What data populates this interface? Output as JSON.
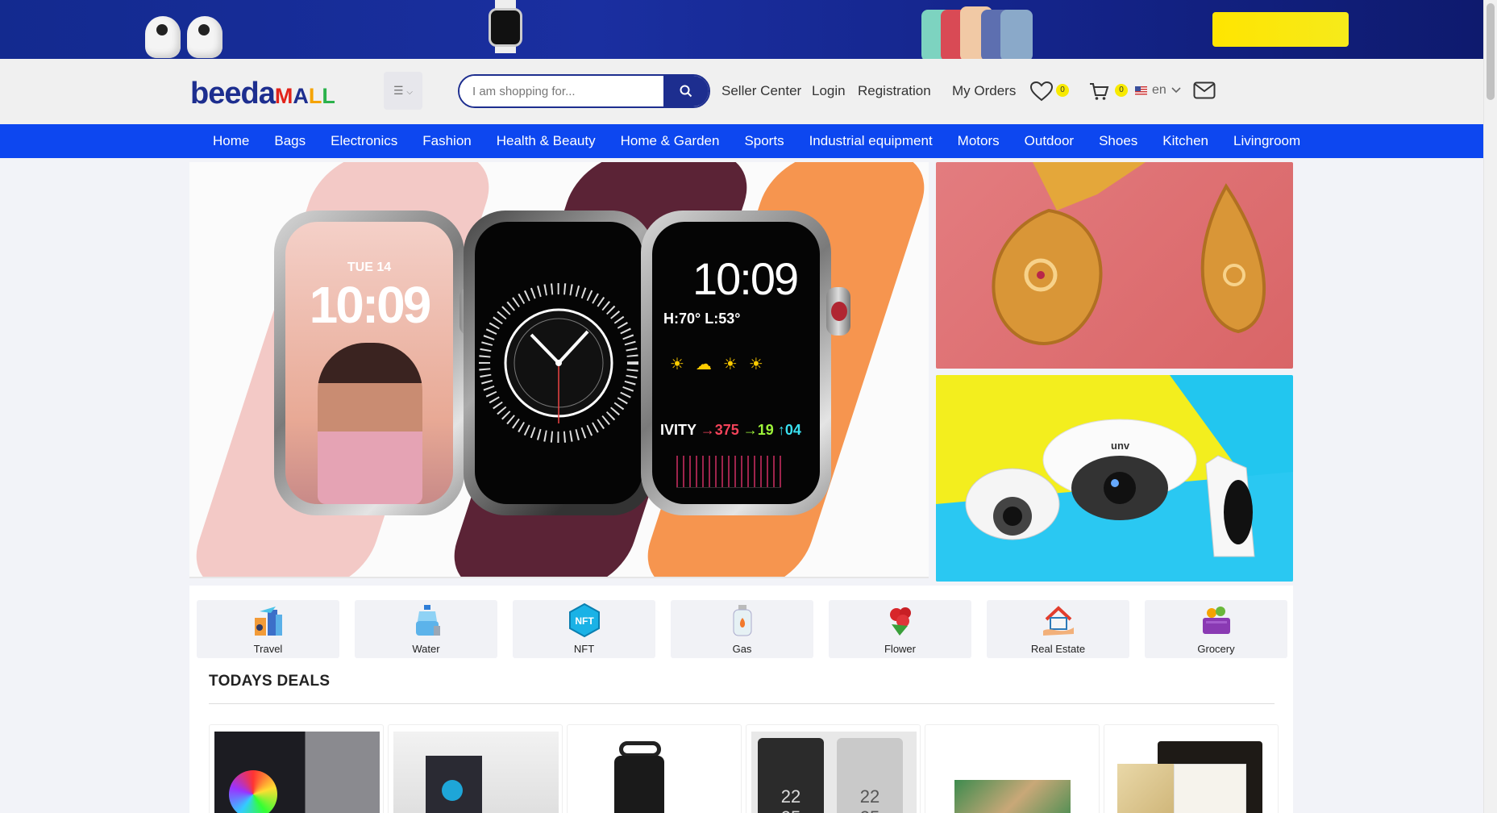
{
  "header": {
    "search": {
      "placeholder": "I am shopping for..."
    },
    "links": {
      "seller_center": "Seller Center",
      "login": "Login",
      "registration": "Registration",
      "my_orders": "My Orders"
    },
    "wishlist_count": "0",
    "cart_count": "0",
    "language": "en"
  },
  "nav": {
    "items": [
      "Home",
      "Bags",
      "Electronics",
      "Fashion",
      "Health & Beauty",
      "Home & Garden",
      "Sports",
      "Industrial equipment",
      "Motors",
      "Outdoor",
      "Shoes",
      "Kitchen",
      "Livingroom"
    ]
  },
  "hero": {
    "watch1": {
      "day": "TUE 14",
      "time": "10:09"
    },
    "watch3": {
      "time": "10:09",
      "temps": "H:70° L:53°",
      "activity": "IVITY",
      "a1": "375",
      "a2": "19",
      "a3": "04"
    },
    "brand": "unv"
  },
  "categories": [
    {
      "label": "Travel",
      "icon": "travel-icon"
    },
    {
      "label": "Water",
      "icon": "water-icon"
    },
    {
      "label": "NFT",
      "icon": "nft-icon"
    },
    {
      "label": "Gas",
      "icon": "gas-icon"
    },
    {
      "label": "Flower",
      "icon": "flower-icon"
    },
    {
      "label": "Real Estate",
      "icon": "real-estate-icon"
    },
    {
      "label": "Grocery",
      "icon": "grocery-icon"
    }
  ],
  "deals": {
    "title": "TODAYS DEALS"
  },
  "colors": {
    "brand_blue": "#1d2e8f",
    "nav_blue": "#0d47f0",
    "badge_yellow": "#f8ea00"
  }
}
